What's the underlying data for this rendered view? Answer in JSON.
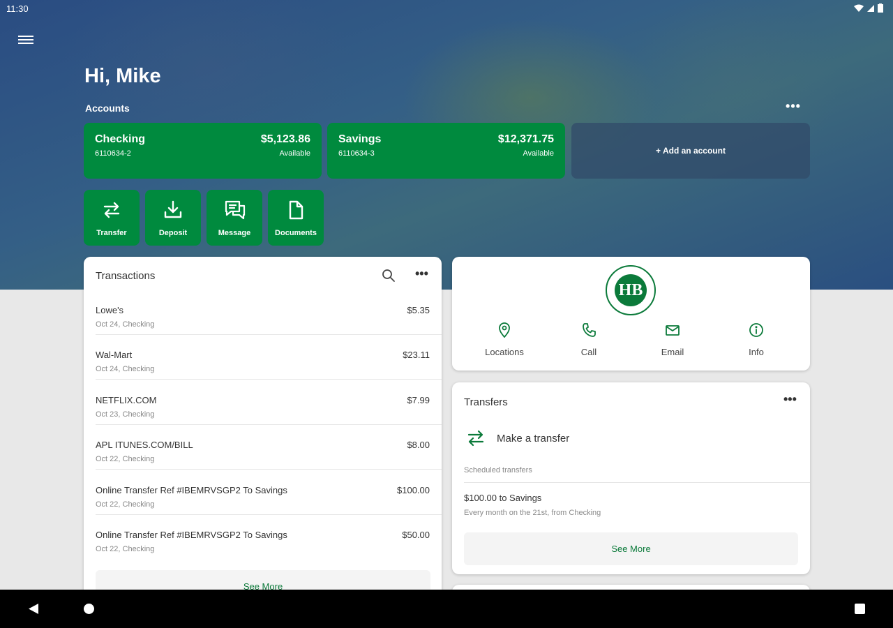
{
  "status": {
    "time": "11:30"
  },
  "header": {
    "greeting": "Hi, Mike",
    "accounts_label": "Accounts",
    "more_label": "•••"
  },
  "accounts": [
    {
      "name": "Checking",
      "number": "6110634-2",
      "balance": "$5,123.86",
      "balance_label": "Available"
    },
    {
      "name": "Savings",
      "number": "6110634-3",
      "balance": "$12,371.75",
      "balance_label": "Available"
    }
  ],
  "add_account_label": "+ Add an account",
  "quick_actions": [
    {
      "label": "Transfer",
      "icon": "transfer-icon"
    },
    {
      "label": "Deposit",
      "icon": "deposit-icon"
    },
    {
      "label": "Message",
      "icon": "message-icon"
    },
    {
      "label": "Documents",
      "icon": "document-icon"
    }
  ],
  "transactions": {
    "title": "Transactions",
    "items": [
      {
        "description": "Lowe's",
        "date_account": "Oct 24, Checking",
        "amount": "$5.35"
      },
      {
        "description": "Wal-Mart",
        "date_account": "Oct 24, Checking",
        "amount": "$23.11"
      },
      {
        "description": "NETFLIX.COM",
        "date_account": "Oct 23, Checking",
        "amount": "$7.99"
      },
      {
        "description": "APL ITUNES.COM/BILL",
        "date_account": "Oct 22, Checking",
        "amount": "$8.00"
      },
      {
        "description": "Online Transfer Ref #IBEMRVSGP2 To Savings",
        "date_account": "Oct 22, Checking",
        "amount": "$100.00"
      },
      {
        "description": "Online Transfer Ref #IBEMRVSGP2 To Savings",
        "date_account": "Oct 22, Checking",
        "amount": "$50.00"
      }
    ],
    "see_more": "See More"
  },
  "bank": {
    "logo_text": "HB",
    "actions": [
      {
        "label": "Locations",
        "icon": "location-pin-icon"
      },
      {
        "label": "Call",
        "icon": "phone-icon"
      },
      {
        "label": "Email",
        "icon": "email-icon"
      },
      {
        "label": "Info",
        "icon": "info-icon"
      }
    ]
  },
  "transfers": {
    "title": "Transfers",
    "make_transfer": "Make a transfer",
    "scheduled_label": "Scheduled transfers",
    "scheduled_item": "$100.00 to Savings",
    "scheduled_detail": "Every month on the 21st, from Checking",
    "see_more": "See More"
  },
  "colors": {
    "brand_green": "#008a3e",
    "accent_green": "#0b7a3a",
    "hero_blue": "#2a4c82"
  }
}
